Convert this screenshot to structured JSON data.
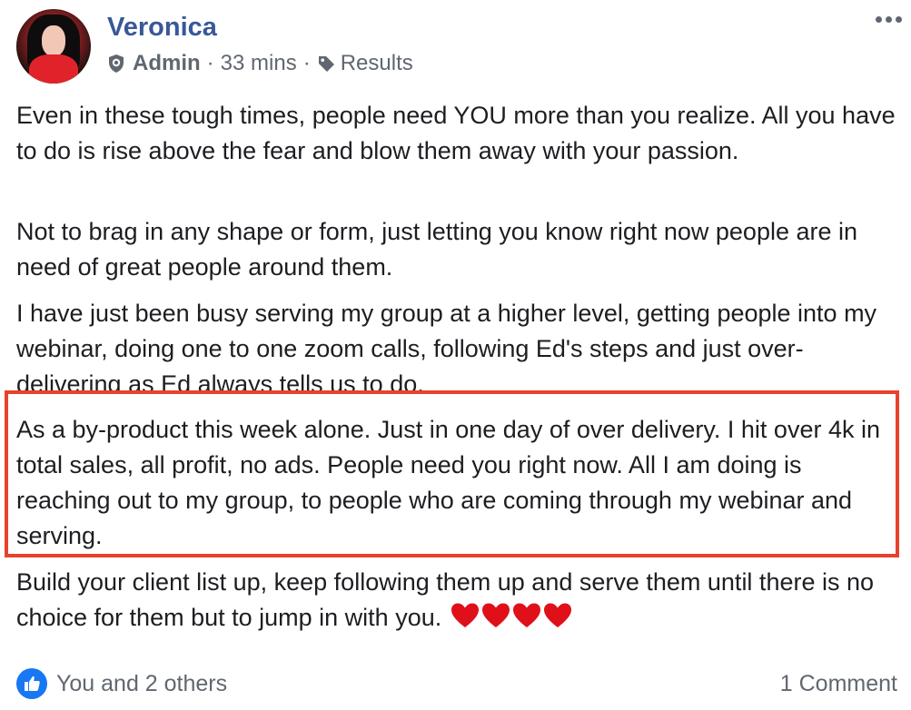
{
  "author": {
    "name": "Veronica",
    "role": "Admin",
    "time": "33 mins",
    "topic": "Results"
  },
  "post": {
    "paragraphs": [
      "Even in these tough times, people need YOU more than you realize. All you have to do is rise above the fear and blow them away with your passion.",
      "Not to brag in any shape or form, just letting you know right now people are in need of great people around them.",
      "I have just been busy serving my group at a higher level, getting people into my webinar, doing one to one zoom calls, following Ed's steps and just over-delivering as Ed always tells us to do.",
      "As a by-product this week alone. Just in one day of over delivery. I hit over 4k in total sales, all profit, no ads. People need you right now. All I am doing is reaching out to my group, to people who are coming through my webinar and serving.",
      "Build your client list up, keep following them up and serve them until there is no choice for them but to jump in with you."
    ],
    "emoji": "heart-icon x4"
  },
  "footer": {
    "reactions": "You and 2 others",
    "comments": "1 Comment"
  },
  "colors": {
    "name": "#385898",
    "meta": "#606770",
    "highlight_border": "#e8412c",
    "like": "#1877f2",
    "heart": "#e0101b"
  }
}
